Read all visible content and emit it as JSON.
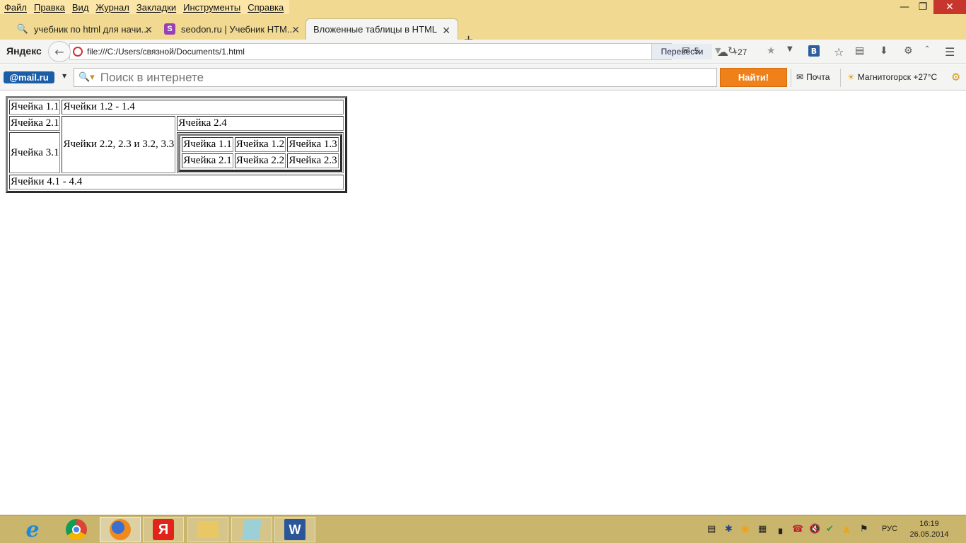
{
  "menu": [
    "Файл",
    "Правка",
    "Вид",
    "Журнал",
    "Закладки",
    "Инструменты",
    "Справка"
  ],
  "tabs": [
    {
      "title": "учебник по html для начи...",
      "icon": "yandex-search-icon"
    },
    {
      "title": "seodon.ru | Учебник HTM...",
      "icon": "seodon-icon"
    },
    {
      "title": "Вложенные таблицы в HTML",
      "icon": "none",
      "active": true
    }
  ],
  "nav": {
    "brand": "Яндекс",
    "url": "file:///C:/Users/связной/Documents/1.html",
    "translate_label": "Перевести",
    "mail_count": "5",
    "weather_temp": "+27"
  },
  "mailru_bar": {
    "logo": "@mail.ru",
    "search_placeholder": "Поиск в интернете",
    "search_button": "Найти!",
    "mail_link": "Почта",
    "weather_link": "Магнитогорск +27°C"
  },
  "page": {
    "cells": {
      "c11": "Ячейка 1.1",
      "c12_14": "Ячейки 1.2 - 1.4",
      "c21": "Ячейка 2.1",
      "c22_33": "Ячейки 2.2, 2.3 и 3.2, 3.3",
      "c24": "Ячейка 2.4",
      "c31": "Ячейка 3.1",
      "c41_44": "Ячейки 4.1 - 4.4"
    },
    "inner_cells": [
      [
        "Ячейка 1.1",
        "Ячейка 1.2",
        "Ячейка 1.3"
      ],
      [
        "Ячейка 2.1",
        "Ячейка 2.2",
        "Ячейка 2.3"
      ]
    ]
  },
  "taskbar": {
    "apps": [
      "internet-explorer",
      "chrome",
      "firefox",
      "yandex-browser",
      "file-explorer",
      "notepad",
      "word"
    ],
    "language": "РУС",
    "time": "16:19",
    "date": "26.05.2014"
  }
}
